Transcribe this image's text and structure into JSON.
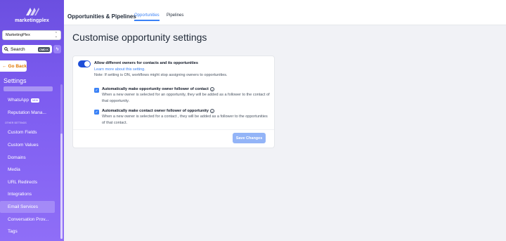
{
  "brand": {
    "name": "marketingplex"
  },
  "account": {
    "selected": "MarketingPlex"
  },
  "search": {
    "label": "Search",
    "shortcut": "CMD K"
  },
  "sidebar": {
    "go_back": "Go Back",
    "title": "Settings",
    "items": [
      {
        "label": "WhatsApp",
        "badge": "NEW"
      },
      {
        "label": "Reputation Mana..."
      },
      {
        "label": "Custom Fields"
      },
      {
        "label": "Custom Values"
      },
      {
        "label": "Domains"
      },
      {
        "label": "Media"
      },
      {
        "label": "URL Redirects"
      },
      {
        "label": "Integrations"
      },
      {
        "label": "Email Services"
      },
      {
        "label": "Conversation Prov..."
      },
      {
        "label": "Tags"
      }
    ],
    "section_label": "OTHER SETTINGS"
  },
  "header": {
    "title": "Opportunities & Pipelines",
    "tabs": [
      {
        "label": "Opportunities",
        "active": true
      },
      {
        "label": "Pipelines",
        "active": false
      }
    ]
  },
  "main": {
    "title": "Customise opportunity settings",
    "toggle": {
      "on": true,
      "title": "Allow different owners for contacts and its opportunities",
      "link": "Learn more about this setting.",
      "note": "Note: If setting is ON, workflows might stop assigning owners to opportunities."
    },
    "checks": [
      {
        "checked": true,
        "title": "Automatically make opportunity owner follower of contact",
        "desc": "When a new owner is selected for an opportunity, they will be added as a follower to the contact of that opportunity."
      },
      {
        "checked": true,
        "title": "Automatically make contact owner follower of opportunity",
        "desc": "When a new owner is selected for a contact , they will be added as a follower to the opportunities of that contact."
      }
    ],
    "save_label": "Save Changes"
  },
  "colors": {
    "accent": "#3b82f6",
    "sidebar": "#7d5cf0",
    "go_back": "#e07800"
  }
}
